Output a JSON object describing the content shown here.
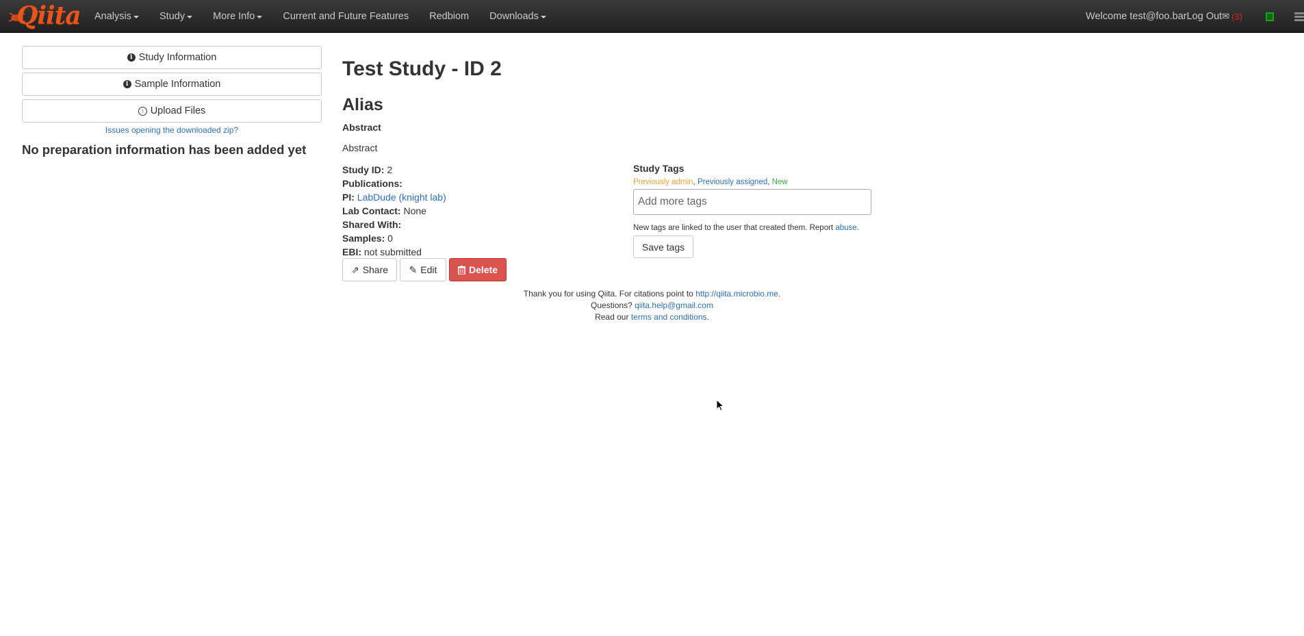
{
  "navbar": {
    "brand": "Qiita",
    "items": [
      {
        "label": "Analysis",
        "dropdown": true
      },
      {
        "label": "Study",
        "dropdown": true
      },
      {
        "label": "More Info",
        "dropdown": true
      },
      {
        "label": "Current and Future Features",
        "dropdown": false
      },
      {
        "label": "Redbiom",
        "dropdown": false
      },
      {
        "label": "Downloads",
        "dropdown": true
      }
    ],
    "welcome": "Welcome test@foo.bar",
    "logout": "Log Out",
    "mail_icon": "envelope-icon",
    "mail_count": "(3)"
  },
  "sidebar": {
    "study_info": "Study Information",
    "sample_info": "Sample Information",
    "upload_files": "Upload Files",
    "zip_link": "Issues opening the downloaded zip?",
    "no_prep": "No preparation information has been added yet"
  },
  "study": {
    "title": "Test Study - ID 2",
    "alias": "Alias",
    "abstract_heading": "Abstract",
    "abstract_text": "Abstract",
    "fields": {
      "study_id_label": "Study ID:",
      "study_id": "2",
      "publications_label": "Publications:",
      "pi_label": "PI:",
      "pi": "LabDude (knight lab)",
      "lab_contact_label": "Lab Contact:",
      "lab_contact": "None",
      "shared_with_label": "Shared With:",
      "samples_label": "Samples:",
      "samples": "0",
      "ebi_label": "EBI:",
      "ebi": "not submitted"
    },
    "actions": {
      "share": "Share",
      "edit": "Edit",
      "delete": "Delete"
    }
  },
  "tags": {
    "heading": "Study Tags",
    "legend_admin": "Previously admin",
    "legend_assigned": "Previously assigned",
    "legend_new": "New",
    "input_placeholder": "Add more tags",
    "note": "New tags are linked to the user that created them. Report",
    "abuse_link": "abuse",
    "save": "Save tags",
    "colors": {
      "admin": "#f0a030",
      "assigned": "#2a6ebb",
      "new": "#3cad3c"
    }
  },
  "footer": {
    "line1_text": "Thank you for using Qiita. For citations point to",
    "line1_link": "http://qiita.microbio.me",
    "line2_text": "Questions?",
    "line2_link": "qiita.help@gmail.com",
    "line3_text": "Read our",
    "line3_link": "terms and conditions"
  }
}
